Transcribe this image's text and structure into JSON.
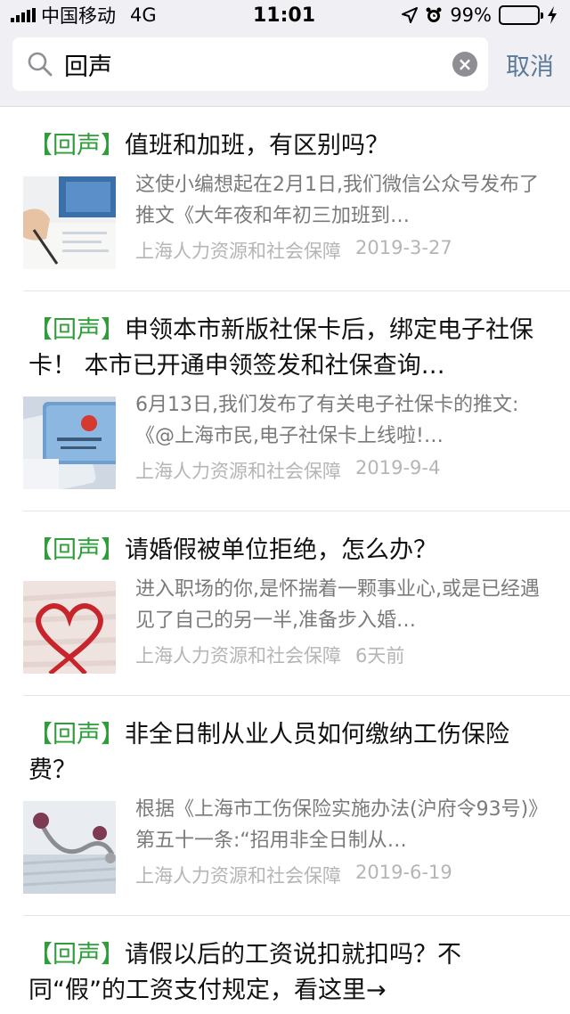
{
  "status": {
    "carrier": "中国移动",
    "network": "4G",
    "time": "11:01",
    "battery": "99%",
    "battery_level": 0.99
  },
  "search": {
    "query": "回声",
    "cancel_label": "取消"
  },
  "accent": "#2f9e3a",
  "results": [
    {
      "tag": "【回声】",
      "title": "值班和加班，有区别吗？",
      "desc": "这使小编想起在2月1日,我们微信公众号发布了推文《大年夜和年初三加班到…",
      "source": "上海人力资源和社会保障",
      "date": "2019-3-27"
    },
    {
      "tag": "【回声】",
      "title": "申领本市新版社保卡后，绑定电子社保卡！ 本市已开通申领签发和社保查询…",
      "desc": "6月13日,我们发布了有关电子社保卡的推文:《@上海市民,电子社保卡上线啦!…",
      "source": "上海人力资源和社会保障",
      "date": "2019-9-4"
    },
    {
      "tag": "【回声】",
      "title": "请婚假被单位拒绝，怎么办？",
      "desc": "进入职场的你,是怀揣着一颗事业心,或是已经遇见了自己的另一半,准备步入婚…",
      "source": "上海人力资源和社会保障",
      "date": "6天前"
    },
    {
      "tag": "【回声】",
      "title": "非全日制从业人员如何缴纳工伤保险费？",
      "desc": "根据《上海市工伤保险实施办法(沪府令93号)》第五十一条:“招用非全日制从…",
      "source": "上海人力资源和社会保障",
      "date": "2019-6-19"
    },
    {
      "tag": "【回声】",
      "title": "请假以后的工资说扣就扣吗？不同“假”的工资支付规定，看这里→",
      "desc": "",
      "source": "",
      "date": ""
    }
  ]
}
